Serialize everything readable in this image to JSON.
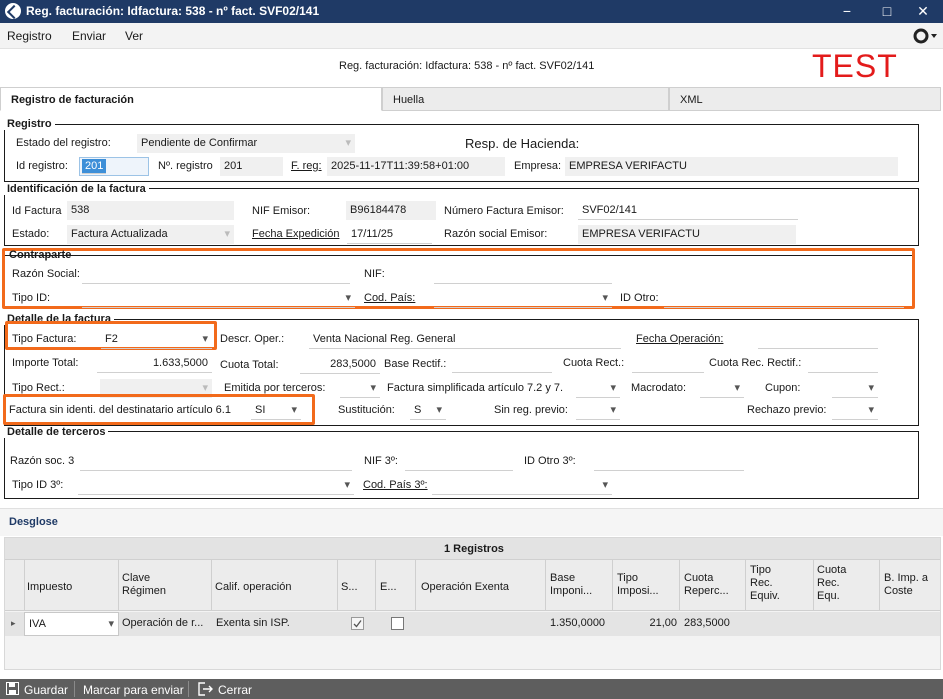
{
  "window": {
    "title": "Reg. facturación: Idfactura: 538 - nº fact. SVF02/141",
    "minimize": "−",
    "maximize": "□",
    "close": "✕"
  },
  "menu": [
    "Registro",
    "Enviar",
    "Ver"
  ],
  "header": {
    "title": "Reg. facturación: Idfactura: 538 - nº fact. SVF02/141",
    "env": "TEST"
  },
  "tabs": [
    "Registro de facturación",
    "Huella",
    "XML"
  ],
  "registro": {
    "legend": "Registro",
    "estado_label": "Estado del registro:",
    "estado_value": "Pendiente de  Confirmar",
    "resp_label": "Resp. de Hacienda:",
    "id_label": "Id registro:",
    "id_value": "201",
    "nreg_label": "Nº. registro",
    "nreg_value": "201",
    "freg_label": "F. reg:",
    "freg_value": "2025-11-17T11:39:58+01:00",
    "empresa_label": "Empresa:",
    "empresa_value": "EMPRESA VERIFACTU"
  },
  "identificacion": {
    "legend": "Identificación de la factura",
    "idfactura_label": "Id Factura",
    "idfactura_value": "538",
    "nif_label": "NIF Emisor:",
    "nif_value": "B96184478",
    "numfact_label": "Número Factura Emisor:",
    "numfact_value": "SVF02/141",
    "estado_label": "Estado:",
    "estado_value": "Factura Actualizada",
    "fecha_label": "Fecha Expedición",
    "fecha_value": "17/11/25",
    "razon_label": "Razón social Emisor:",
    "razon_value": "EMPRESA VERIFACTU"
  },
  "contraparte": {
    "legend": "Contraparte",
    "razon_label": "Razón Social:",
    "nif_label": "NIF:",
    "tipoid_label": "Tipo ID:",
    "codpais_label": "Cod. País:",
    "idotro_label": "ID Otro:"
  },
  "detalle": {
    "legend": "Detalle de la factura",
    "tipo_label": "Tipo Factura:",
    "tipo_value": "F2",
    "descr_label": "Descr. Oper.:",
    "descr_value": "Venta Nacional Reg. General",
    "fechaop_label": "Fecha Operación:",
    "importe_label": "Importe Total:",
    "importe_value": "1.633,5000",
    "cuota_label": "Cuota Total:",
    "cuota_value": "283,5000",
    "base_label": "Base Rectif.:",
    "cuotarect_label": "Cuota Rect.:",
    "cuotarecrect_label": "Cuota Rec. Rectif.:",
    "tiporect_label": "Tipo Rect.:",
    "emitida_label": "Emitida por terceros:",
    "simplificada_label": "Factura simplificada artículo 7.2 y 7.",
    "macrodato_label": "Macrodato:",
    "cupon_label": "Cupon:",
    "sinident_label": "Factura sin identi. del destinatario artículo 6.1",
    "sinident_value": "SI",
    "sustitucion_label": "Sustitución:",
    "sustitucion_value": "S",
    "sinreg_label": "Sin reg. previo:",
    "rechazo_label": "Rechazo previo:"
  },
  "terceros": {
    "legend": "Detalle de terceros",
    "razon_label": "Razón soc. 3",
    "nif_label": "NIF 3º:",
    "idotro_label": "ID Otro 3º:",
    "tipoid_label": "Tipo ID 3º:",
    "codpais_label": "Cod. País 3º:"
  },
  "desglose": {
    "title": "Desglose",
    "count": "1 Registros",
    "columns": [
      "Impuesto",
      "Clave Régimen",
      "Calif. operación",
      "S...",
      "E...",
      "Operación Exenta",
      "Base Imponi...",
      "Tipo Imposi...",
      "Cuota Reperc...",
      "Tipo Rec. Equiv.",
      "Cuota Rec. Equ.",
      "B. Imp. a Coste"
    ],
    "row": {
      "impuesto": "IVA",
      "clave": "Operación de r...",
      "calif": "Exenta sin ISP.",
      "s_checked": true,
      "e_checked": false,
      "base": "1.350,0000",
      "tipo": "21,00",
      "cuota": "283,5000"
    }
  },
  "bottombar": {
    "guardar": "Guardar",
    "marcar": "Marcar para enviar",
    "cerrar": "Cerrar"
  },
  "colors": {
    "titlebar": "#1f3a66",
    "highlight": "#f26a1b",
    "test": "#e31b1b",
    "selection": "#3d8fd8"
  }
}
